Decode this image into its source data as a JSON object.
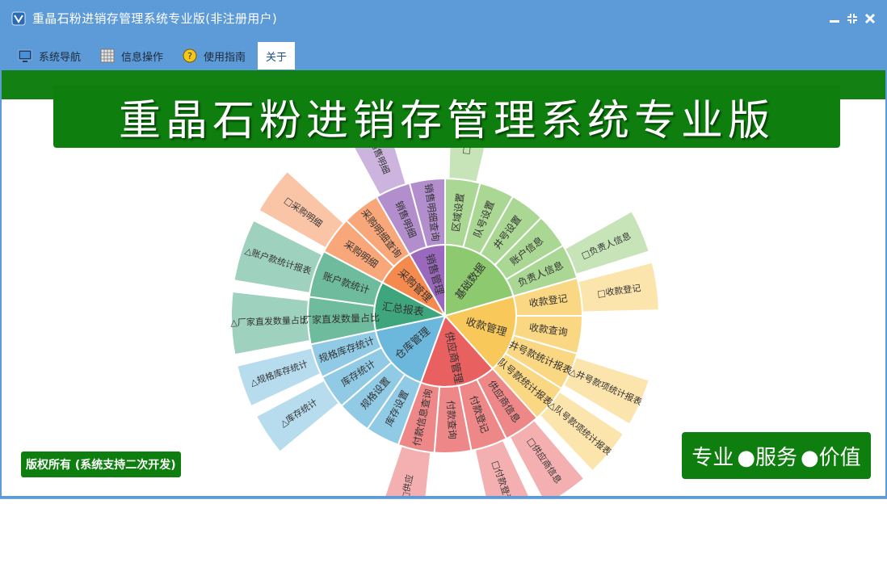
{
  "window": {
    "title": "重晶石粉进销存管理系统专业版(非注册用户)"
  },
  "menu": [
    {
      "label": "系统导航",
      "icon": "monitor-icon"
    },
    {
      "label": "信息操作",
      "icon": "grid-icon"
    },
    {
      "label": "使用指南",
      "icon": "help-icon"
    },
    {
      "label": "关于",
      "icon": ""
    }
  ],
  "banner": {
    "title": "重晶石粉进销存管理系统专业版"
  },
  "copyright": "版权所有 (系统支持二次开发)",
  "slogan": {
    "items": [
      "专业",
      "●服务",
      "●价值"
    ]
  },
  "sunburst": {
    "center": "",
    "sectors": [
      {
        "name": "基础数据",
        "color": "#8dc96f",
        "children": [
          {
            "name": "区域设置",
            "leaf": "□区域"
          },
          {
            "name": "队号设置",
            "leaf": ""
          },
          {
            "name": "井号设置",
            "leaf": ""
          },
          {
            "name": "账户信息",
            "leaf": ""
          },
          {
            "name": "负责人信息",
            "leaf": "□负责人信息"
          }
        ]
      },
      {
        "name": "收款管理",
        "color": "#f8c95a",
        "children": [
          {
            "name": "收款登记",
            "leaf": "□收款登记"
          },
          {
            "name": "收款查询",
            "leaf": ""
          },
          {
            "name": "井号款统计报表",
            "leaf": "△井号款项统计报表"
          },
          {
            "name": "队号款统计报表",
            "leaf": "△队号款项统计报表"
          }
        ]
      },
      {
        "name": "供应商管理",
        "color": "#e86060",
        "children": [
          {
            "name": "供应商信息",
            "leaf": "□供应商信息"
          },
          {
            "name": "付款登记",
            "leaf": "□付款登记"
          },
          {
            "name": "付款查询",
            "leaf": ""
          },
          {
            "name": "付款信息查询",
            "leaf": "□供应"
          }
        ]
      },
      {
        "name": "仓库管理",
        "color": "#6cb8dc",
        "children": [
          {
            "name": "库存设置",
            "leaf": ""
          },
          {
            "name": "规格设置",
            "leaf": ""
          },
          {
            "name": "库存统计",
            "leaf": "△库存统计"
          },
          {
            "name": "规格库存统计",
            "leaf": "△规格库存统计"
          }
        ]
      },
      {
        "name": "汇总报表",
        "color": "#3ea57c",
        "children": [
          {
            "name": "厂家直发数量占比",
            "leaf": "△厂家直发数量占比"
          },
          {
            "name": "账户款统计",
            "leaf": "△账户款统计报表"
          }
        ]
      },
      {
        "name": "采购管理",
        "color": "#f58a4e",
        "children": [
          {
            "name": "采购明细",
            "leaf": "□采购明细"
          },
          {
            "name": "采购明细查询",
            "leaf": ""
          }
        ]
      },
      {
        "name": "销售管理",
        "color": "#9a68bc",
        "children": [
          {
            "name": "销售明细",
            "leaf": "□销售明细"
          },
          {
            "name": "销售明细查询",
            "leaf": ""
          }
        ]
      }
    ]
  }
}
